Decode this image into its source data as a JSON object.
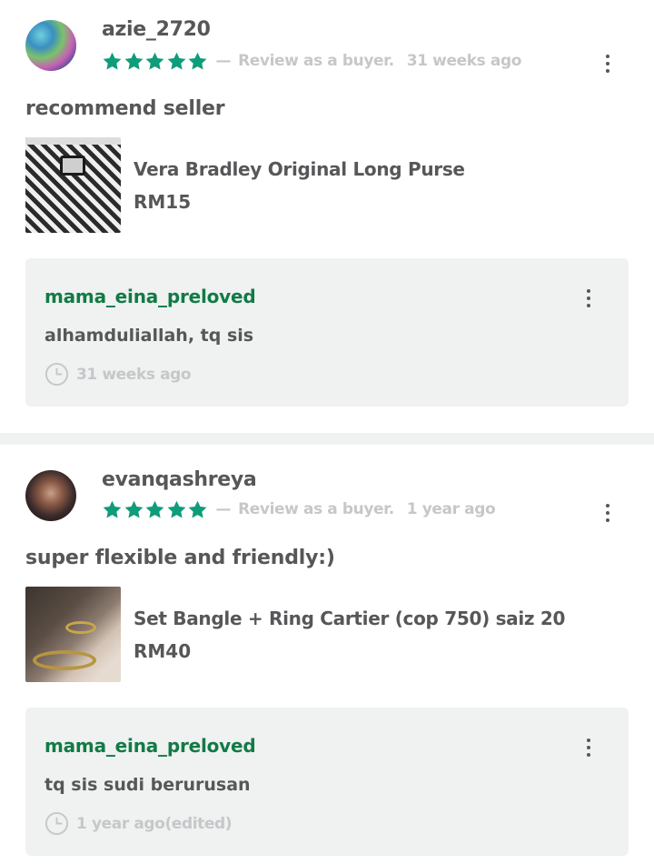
{
  "colors": {
    "star": "#0f9c7a",
    "seller_name": "#127a46",
    "muted": "#c6c7c9",
    "text": "#57575a",
    "reply_bg": "#f0f1f1"
  },
  "reviews": [
    {
      "username": "azie_2720",
      "rating": 5,
      "role_label": "Review as a buyer.",
      "time": "31 weeks ago",
      "comment": "recommend seller",
      "avatar_icon": "avatar-photo",
      "product": {
        "name": "Vera Bradley Original Long Purse",
        "price": "RM15",
        "thumbnail_icon": "houndstooth-purse-photo"
      },
      "reply": {
        "seller": "mama_eina_preloved",
        "text": "alhamduliallah, tq sis",
        "time": "31 weeks ago"
      }
    },
    {
      "username": "evanqashreya",
      "rating": 5,
      "role_label": "Review as a buyer.",
      "time": "1 year ago",
      "comment": "super flexible and friendly:)",
      "avatar_icon": "avatar-photo",
      "product": {
        "name": "Set Bangle + Ring Cartier (cop 750) saiz 20",
        "price": "RM40",
        "thumbnail_icon": "bangle-ring-photo"
      },
      "reply": {
        "seller": "mama_eina_preloved",
        "text": "tq sis sudi berurusan",
        "time": "1 year ago(edited)"
      }
    }
  ],
  "separator_dash": "—"
}
